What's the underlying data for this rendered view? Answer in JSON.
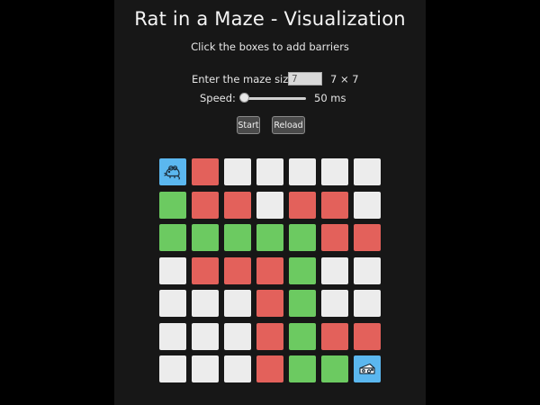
{
  "header": {
    "title": "Rat in a Maze - Visualization",
    "subtitle": "Click the boxes to add barriers"
  },
  "controls": {
    "size_label": "Enter the maze size:",
    "size_value": "7",
    "size_display": "7 × 7",
    "speed_label": "Speed:",
    "speed_value": "50 ms",
    "speed_level": 0.0,
    "start_label": "Start",
    "reload_label": "Reload"
  },
  "colors": {
    "open": "#ececec",
    "barrier": "#e3615b",
    "path": "#6cca61",
    "endpoint": "#5bb7ef"
  },
  "maze": {
    "size": 7,
    "rows": [
      [
        "rat",
        "red",
        "white",
        "white",
        "white",
        "white",
        "white"
      ],
      [
        "green",
        "red",
        "red",
        "white",
        "red",
        "red",
        "white"
      ],
      [
        "green",
        "green",
        "green",
        "green",
        "green",
        "red",
        "red"
      ],
      [
        "white",
        "red",
        "red",
        "red",
        "green",
        "white",
        "white"
      ],
      [
        "white",
        "white",
        "white",
        "red",
        "green",
        "white",
        "white"
      ],
      [
        "white",
        "white",
        "white",
        "red",
        "green",
        "red",
        "red"
      ],
      [
        "white",
        "white",
        "white",
        "red",
        "green",
        "green",
        "cheese"
      ]
    ],
    "start_icon": "rat-icon",
    "goal_icon": "cheese-icon"
  }
}
